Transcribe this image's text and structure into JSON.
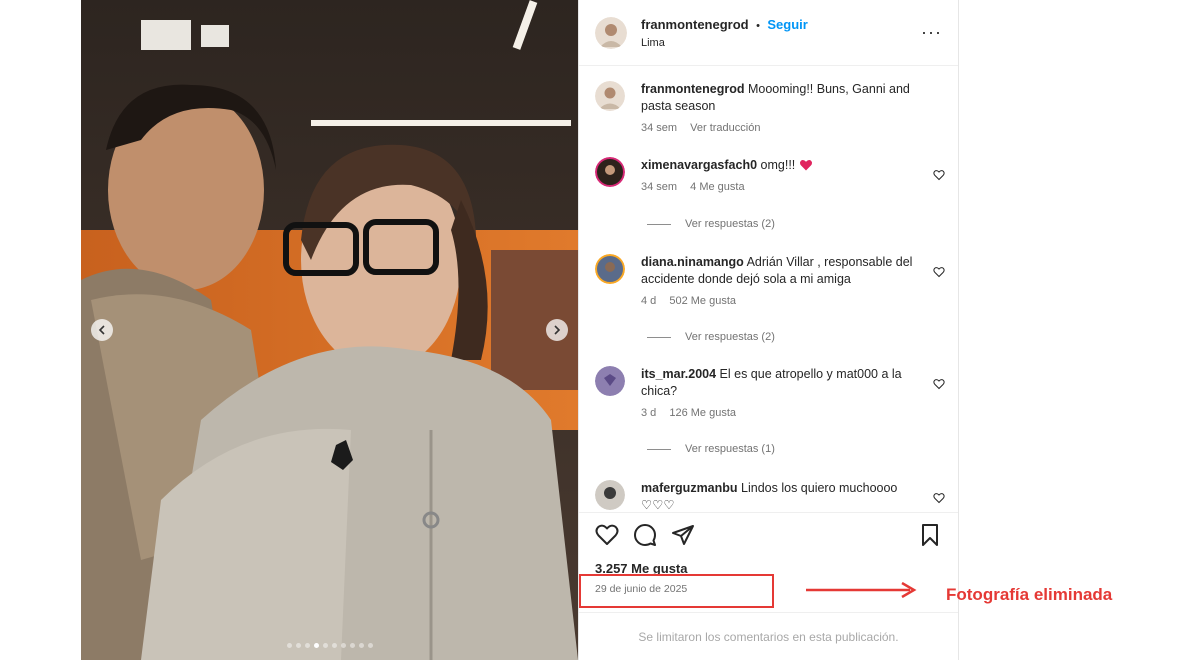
{
  "post": {
    "username": "franmontenegrod",
    "separator": "•",
    "follow_label": "Seguir",
    "location": "Lima",
    "more_label": "···",
    "caption": {
      "username": "franmontenegrod",
      "text": "Moooming!! Buns, Ganni and pasta season",
      "time": "34 sem",
      "translate": "Ver traducción"
    }
  },
  "comments": [
    {
      "username": "ximenavargasfach0",
      "text": "omg!!!",
      "time": "34 sem",
      "likes": "4 Me gusta",
      "replies": "Ver respuestas (2)"
    },
    {
      "username": "diana.ninamango",
      "text": "Adrián Villar , responsable del accidente donde dejó sola a mi amiga",
      "time": "4 d",
      "likes": "502 Me gusta",
      "replies": "Ver respuestas (2)"
    },
    {
      "username": "its_mar.2004",
      "text": "El es que atropello y mat000 a la chica?",
      "time": "3 d",
      "likes": "126 Me gusta",
      "replies": "Ver respuestas (1)"
    },
    {
      "username": "maferguzmanbu",
      "text": "Lindos los quiero muchoooo ♡♡♡"
    }
  ],
  "likes_count": "3.257 Me gusta",
  "date": "29 de junio de 2025",
  "comments_limited": "Se limitaron los comentarios en esta publicación.",
  "annotation": "Fotografía eliminada",
  "carousel": {
    "total": 10,
    "active": 3
  },
  "colors": {
    "accent_blue": "#0095f6",
    "annotation_red": "#e53935",
    "heart_red": "#e0245e"
  }
}
